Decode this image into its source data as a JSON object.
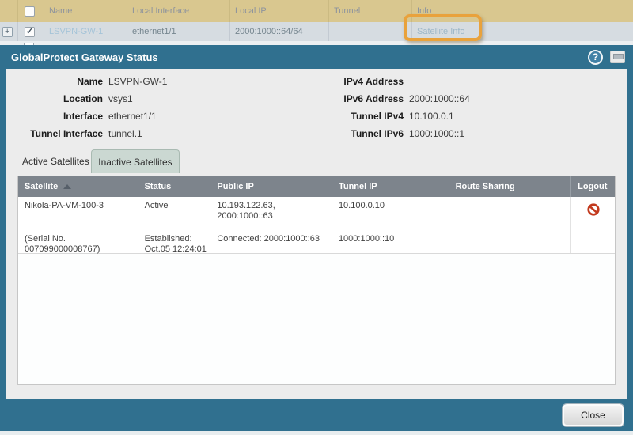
{
  "top_table": {
    "headers": {
      "name": "Name",
      "local_interface": "Local Interface",
      "local_ip": "Local IP",
      "tunnel": "Tunnel",
      "info": "Info"
    },
    "row": {
      "name": "LSVPN-GW-1",
      "local_interface": "ethernet1/1",
      "local_ip": "2000:1000::64/64",
      "tunnel": "",
      "info": "Satellite Info"
    }
  },
  "dialog": {
    "title": "GlobalProtect Gateway Status",
    "help_glyph": "?",
    "fields": {
      "left": [
        {
          "label": "Name",
          "value": "LSVPN-GW-1"
        },
        {
          "label": "Location",
          "value": "vsys1"
        },
        {
          "label": "Interface",
          "value": "ethernet1/1"
        },
        {
          "label": "Tunnel Interface",
          "value": "tunnel.1"
        }
      ],
      "right": [
        {
          "label": "IPv4 Address",
          "value": ""
        },
        {
          "label": "IPv6 Address",
          "value": "2000:1000::64"
        },
        {
          "label": "Tunnel IPv4",
          "value": "10.100.0.1"
        },
        {
          "label": "Tunnel IPv6",
          "value": "1000:1000::1"
        }
      ]
    },
    "tabs": [
      {
        "label": "Active Satellites"
      },
      {
        "label": "Inactive Satellites"
      }
    ],
    "table": {
      "headers": {
        "satellite": "Satellite",
        "status": "Status",
        "public_ip": "Public IP",
        "tunnel_ip": "Tunnel IP",
        "route_sharing": "Route Sharing",
        "logout": "Logout"
      },
      "rows": [
        {
          "satellite": "Nikola-PA-VM-100-3",
          "satellite_serial": "(Serial No. 007099000008767)",
          "status": "Active",
          "status_detail": "Established: Oct.05 12:24:01",
          "public_ip": "10.193.122.63, 2000:1000::63",
          "public_ip_detail": "Connected: 2000:1000::63",
          "tunnel_ip": "10.100.0.10",
          "tunnel_ip_detail": "1000:1000::10",
          "route_sharing": ""
        }
      ]
    },
    "close_label": "Close"
  },
  "colors": {
    "accent_teal": "#30708f",
    "header_tan": "#d9c78f",
    "annotation_orange": "#e9a23c",
    "logout_red": "#c23a1e"
  }
}
